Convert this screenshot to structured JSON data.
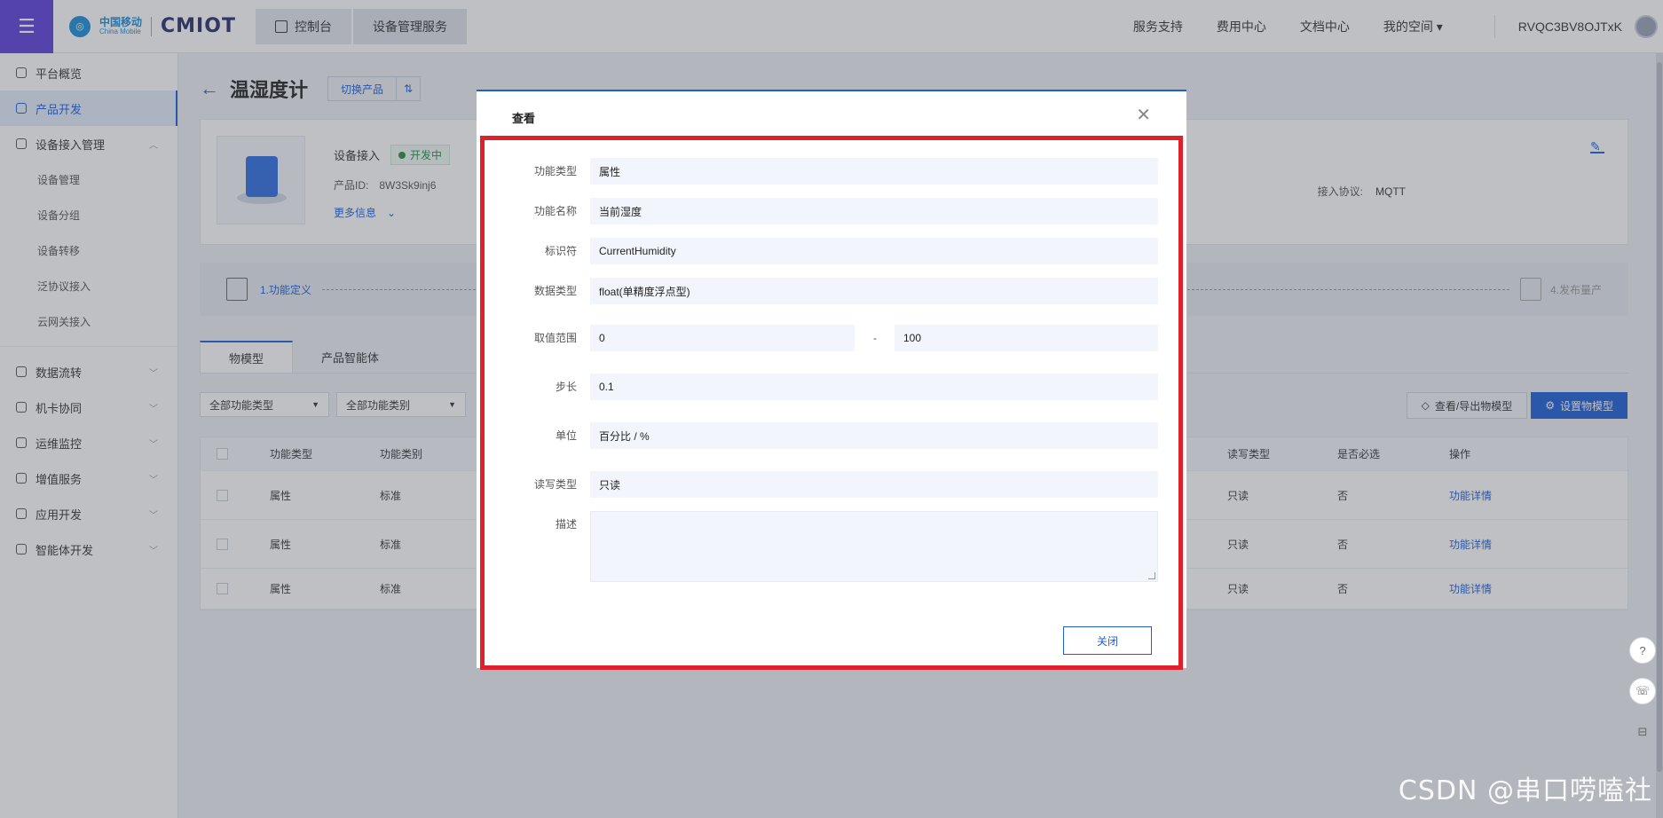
{
  "topbar": {
    "menu_icon": "hamburger-icon",
    "logo_cn": "中国移动",
    "logo_en": "China Mobile",
    "brand": "CMIOT",
    "crumbs": [
      "控制台",
      "设备管理服务"
    ],
    "nav": [
      "服务支持",
      "费用中心",
      "文档中心",
      "我的空间"
    ],
    "user": "RVQC3BV8OJTxK"
  },
  "sidebar": {
    "items": [
      {
        "label": "平台概览",
        "active": false
      },
      {
        "label": "产品开发",
        "active": true
      },
      {
        "label": "设备接入管理",
        "active": false
      }
    ],
    "sub_items": [
      "设备管理",
      "设备分组",
      "设备转移",
      "泛协议接入",
      "云网关接入"
    ],
    "groups": [
      "数据流转",
      "机卡协同",
      "运维监控",
      "增值服务",
      "应用开发",
      "智能体开发"
    ]
  },
  "product": {
    "title": "温湿度计",
    "switch_label": "切换产品",
    "access_type": "设备接入",
    "status": "开发中",
    "id_label": "产品ID:",
    "id_value": "8W3Sk9inj6",
    "more": "更多信息",
    "protocol_label": "接入协议:",
    "protocol_value": "MQTT"
  },
  "steps": {
    "step1": "1.功能定义",
    "step4": "4.发布量产"
  },
  "tabs": [
    "物模型",
    "产品智能体"
  ],
  "filters": [
    "全部功能类型",
    "全部功能类别"
  ],
  "actions": {
    "view_export": "查看/导出物模型",
    "setup": "设置物模型"
  },
  "table": {
    "headers": [
      "功能类型",
      "功能类别",
      "读写类型",
      "是否必选",
      "操作"
    ],
    "rows": [
      [
        "属性",
        "标准",
        "只读",
        "否",
        "功能详情"
      ],
      [
        "属性",
        "标准",
        "只读",
        "否",
        "功能详情"
      ],
      [
        "属性",
        "标准",
        "只读",
        "否",
        "功能详情"
      ]
    ]
  },
  "dialog": {
    "title": "查看",
    "fields": {
      "type_label": "功能类型",
      "type_value": "属性",
      "name_label": "功能名称",
      "name_value": "当前湿度",
      "id_label": "标识符",
      "id_value": "CurrentHumidity",
      "dtype_label": "数据类型",
      "dtype_value": "float(单精度浮点型)",
      "range_label": "取值范围",
      "range_min": "0",
      "range_sep": "-",
      "range_max": "100",
      "step_label": "步长",
      "step_value": "0.1",
      "unit_label": "单位",
      "unit_value": "百分比 / %",
      "rw_label": "读写类型",
      "rw_value": "只读",
      "desc_label": "描述",
      "desc_value": ""
    },
    "close_button": "关闭"
  },
  "watermark": "CSDN @串口唠嗑社",
  "colors": {
    "accent": "#1e5fd8",
    "menu": "#5b3fd8",
    "highlight": "#e0202a"
  }
}
